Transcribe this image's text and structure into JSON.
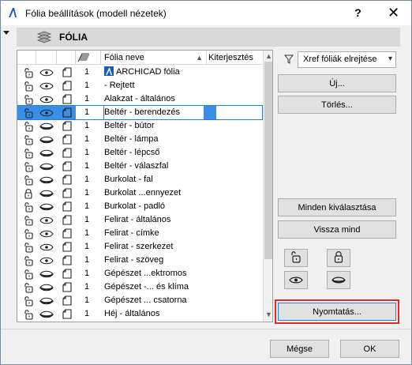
{
  "window": {
    "title": "Fólia beállítások (modell nézetek)",
    "help_label": "?",
    "close_label": "✕"
  },
  "section": {
    "title": "FÓLIA"
  },
  "table": {
    "headers": {
      "name": "Fólia neve",
      "ext": "Kiterjesztés"
    },
    "rows": [
      {
        "num": "1",
        "name": "ARCHICAD fólia",
        "has_logo": true,
        "lock": "open",
        "eye": "open",
        "selected": false
      },
      {
        "num": "1",
        "name": "- Rejtett",
        "lock": "open",
        "eye": "open",
        "selected": false
      },
      {
        "num": "1",
        "name": "Alakzat - általános",
        "lock": "open",
        "eye": "open",
        "selected": false
      },
      {
        "num": "1",
        "name": "Beltér - berendezés",
        "lock": "open",
        "eye": "open",
        "selected": true
      },
      {
        "num": "1",
        "name": "Beltér - bútor",
        "lock": "open",
        "eye": "solid",
        "selected": false
      },
      {
        "num": "1",
        "name": "Beltér - lámpa",
        "lock": "open",
        "eye": "solid",
        "selected": false
      },
      {
        "num": "1",
        "name": "Beltér - lépcső",
        "lock": "open",
        "eye": "solid",
        "selected": false
      },
      {
        "num": "1",
        "name": "Beltér - válaszfal",
        "lock": "open",
        "eye": "solid",
        "selected": false
      },
      {
        "num": "1",
        "name": "Burkolat - fal",
        "lock": "open",
        "eye": "solid",
        "selected": false
      },
      {
        "num": "1",
        "name": "Burkolat ...ennyezet",
        "lock": "closed",
        "eye": "solid",
        "selected": false
      },
      {
        "num": "1",
        "name": "Burkolat - padló",
        "lock": "open",
        "eye": "solid",
        "selected": false
      },
      {
        "num": "1",
        "name": "Felirat - általános",
        "lock": "open",
        "eye": "open",
        "selected": false
      },
      {
        "num": "1",
        "name": "Felirat - címke",
        "lock": "open",
        "eye": "open",
        "selected": false
      },
      {
        "num": "1",
        "name": "Felirat - szerkezet",
        "lock": "open",
        "eye": "open",
        "selected": false
      },
      {
        "num": "1",
        "name": "Felirat - szöveg",
        "lock": "open",
        "eye": "open",
        "selected": false
      },
      {
        "num": "1",
        "name": "Gépészet ...ektromos",
        "lock": "open",
        "eye": "solid",
        "selected": false
      },
      {
        "num": "1",
        "name": "Gépészet -... és klíma",
        "lock": "open",
        "eye": "solid",
        "selected": false
      },
      {
        "num": "1",
        "name": "Gépészet ... csatorna",
        "lock": "open",
        "eye": "solid",
        "selected": false
      },
      {
        "num": "1",
        "name": "Héj - általános",
        "lock": "open",
        "eye": "solid",
        "selected": false
      }
    ]
  },
  "panel": {
    "xref_select_value": "Xref fóliák elrejtése",
    "new_label": "Új...",
    "delete_label": "Törlés...",
    "select_all_label": "Minden kiválasztása",
    "restore_all_label": "Vissza mind",
    "print_label": "Nyomtatás..."
  },
  "footer": {
    "cancel_label": "Mégse",
    "ok_label": "OK"
  },
  "colors": {
    "selection_blue": "#3a8ee6",
    "highlight_red": "#e02a2a",
    "archicad_blue": "#1a5bb5"
  }
}
